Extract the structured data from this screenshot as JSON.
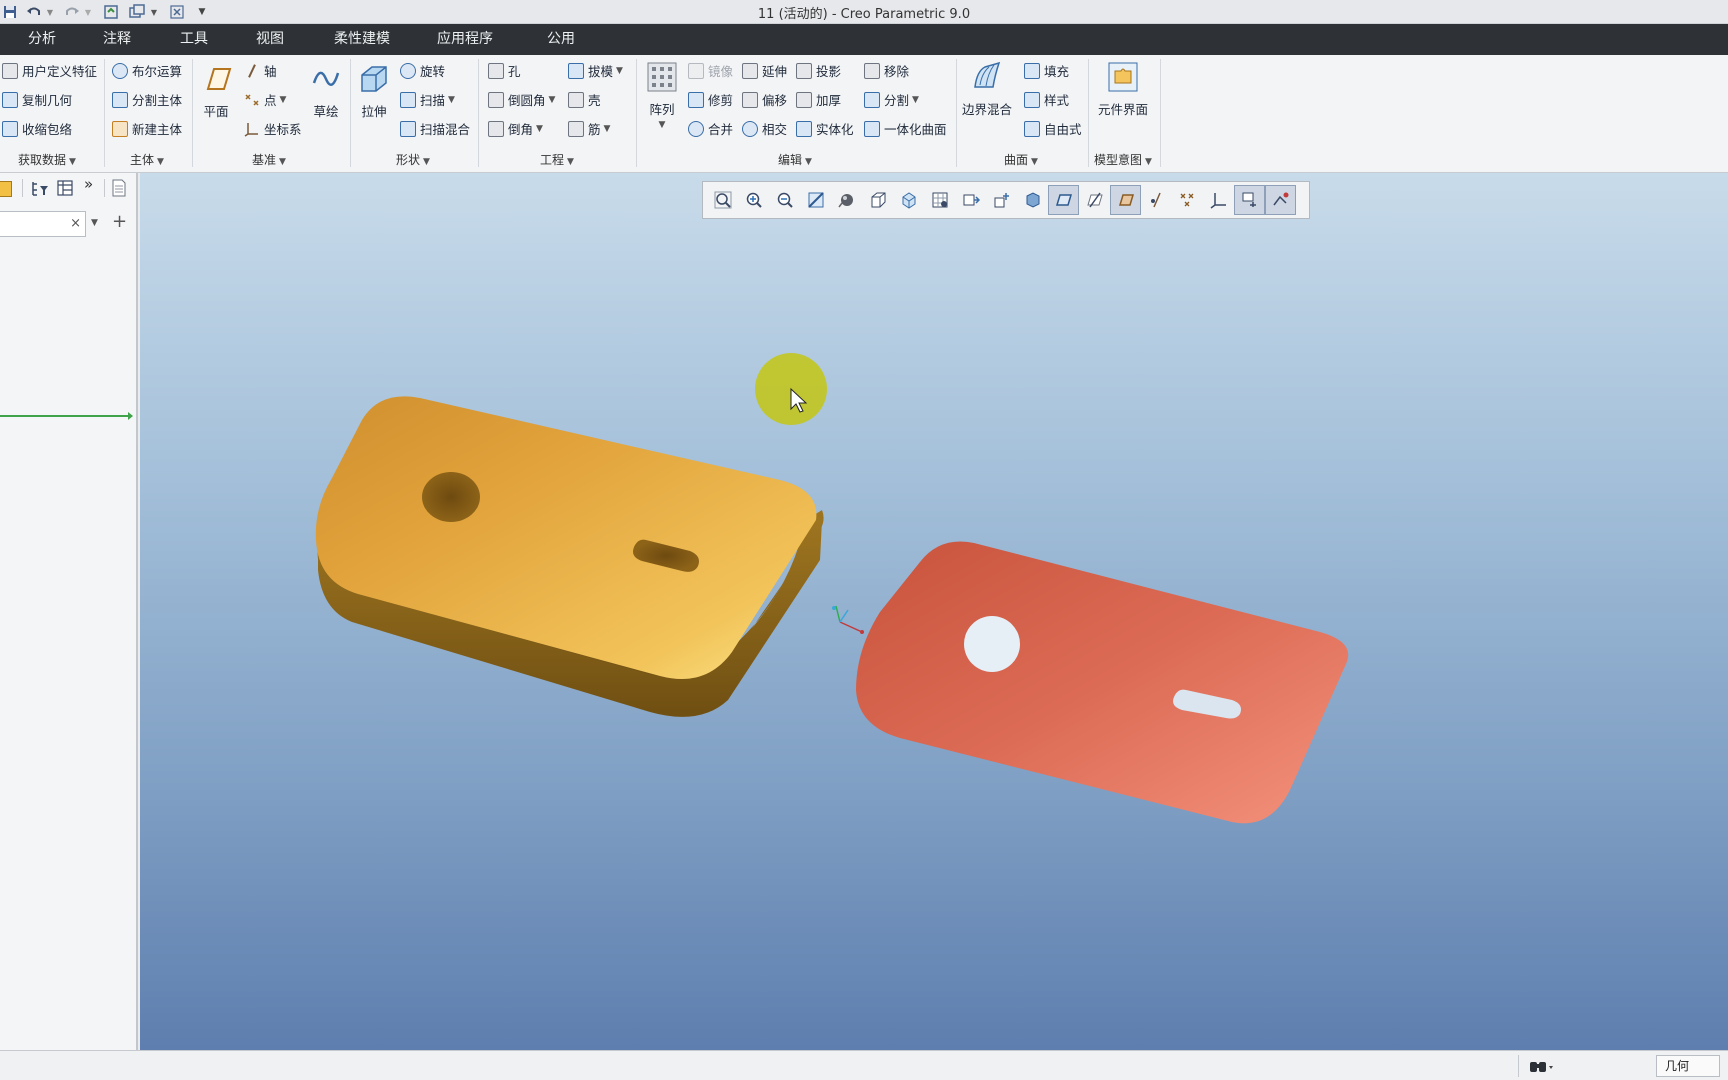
{
  "window": {
    "title": "11 (活动的) - Creo Parametric 9.0"
  },
  "quick_access": {
    "icons": [
      "save-icon",
      "undo-icon",
      "redo-icon",
      "regenerate-icon",
      "windows-icon",
      "close-window-icon",
      "customize-icon"
    ]
  },
  "menu": {
    "tabs": [
      "分析",
      "注释",
      "工具",
      "视图",
      "柔性建模",
      "应用程序",
      "公用"
    ]
  },
  "ribbon": {
    "get_data": {
      "items": [
        "用户定义特征",
        "复制几何",
        "收缩包络"
      ],
      "label": "获取数据"
    },
    "body": {
      "items": [
        "布尔运算",
        "分割主体",
        "新建主体"
      ],
      "label": "主体"
    },
    "datum": {
      "plane": "平面",
      "items": [
        "轴",
        "点",
        "坐标系"
      ],
      "sketch": "草绘",
      "label": "基准"
    },
    "shapes": {
      "extrude": "拉伸",
      "items": [
        "旋转",
        "扫描",
        "扫描混合"
      ],
      "label": "形状"
    },
    "engineering": {
      "col1": [
        "孔",
        "倒圆角",
        "倒角"
      ],
      "col2": [
        "拔模",
        "壳",
        "筋"
      ],
      "label": "工程"
    },
    "editing": {
      "pattern": "阵列",
      "col1": [
        "镜像",
        "修剪",
        "合并"
      ],
      "col2": [
        "延伸",
        "偏移",
        "相交"
      ],
      "col3": [
        "投影",
        "加厚",
        "实体化"
      ],
      "col4": [
        "移除",
        "分割",
        "一体化曲面"
      ],
      "label": "编辑"
    },
    "surfaces": {
      "boundary_blend": "边界混合",
      "items": [
        "填充",
        "样式",
        "自由式"
      ],
      "label": "曲面"
    },
    "model_intent": {
      "component_interface": "元件界面",
      "label": "模型意图"
    }
  },
  "left_panel": {
    "search_value": ""
  },
  "status": {
    "filter": "几何"
  },
  "colors": {
    "part1_top": "#e0a23a",
    "part1_side": "#8a6418",
    "part2": "#d9634e",
    "cursor_highlight": "#c3c619"
  }
}
